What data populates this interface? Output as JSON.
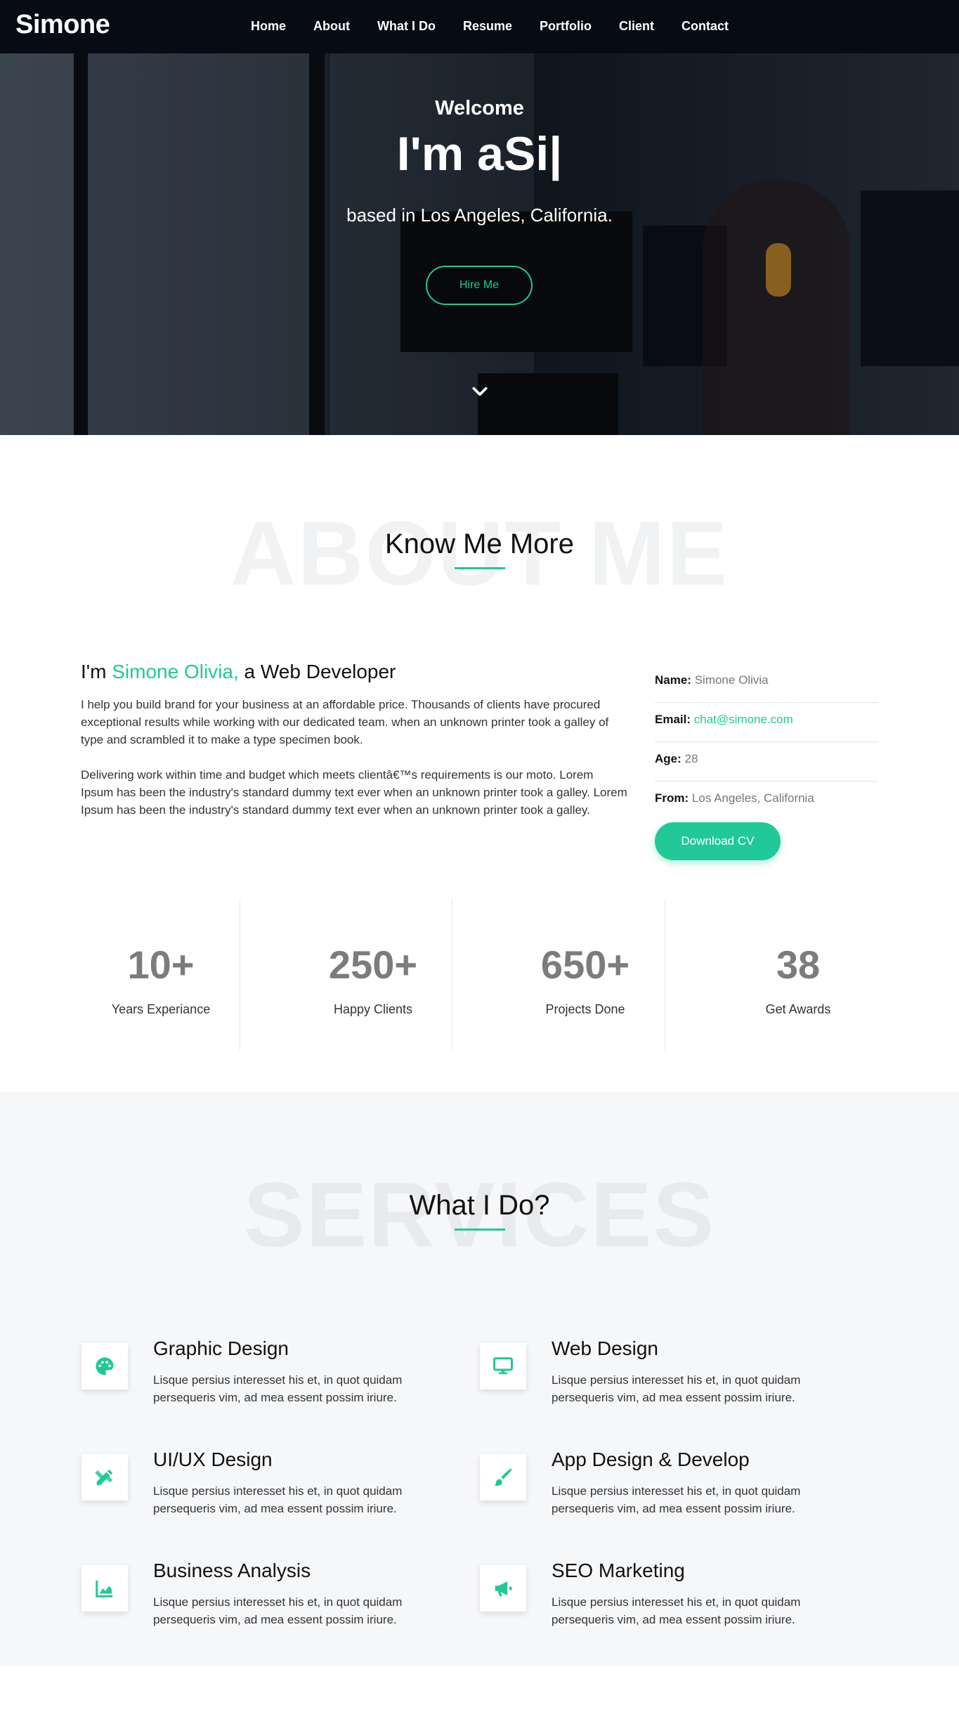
{
  "nav": {
    "brand": "Simone",
    "items": [
      "Home",
      "About",
      "What I Do",
      "Resume",
      "Portfolio",
      "Client",
      "Contact"
    ]
  },
  "hero": {
    "welcome": "Welcome",
    "typed": "I'm aSi|",
    "based": "based in Los Angeles, California.",
    "hire": "Hire Me",
    "scroll_icon": "chevron-down-icon"
  },
  "about": {
    "bg_title": "ABOUT ME",
    "title": "Know Me More",
    "head_prefix": "I'm ",
    "head_name": "Simone Olivia,",
    "head_suffix": " a Web Developer",
    "p1": "I help you build brand for your business at an affordable price. Thousands of clients have procured exceptional results while working with our dedicated team. when an unknown printer took a galley of type and scrambled it to make a type specimen book.",
    "p2": "Delivering work within time and budget which meets clientâ€™s requirements is our moto. Lorem Ipsum has been the industry's standard dummy text ever when an unknown printer took a galley. Lorem Ipsum has been the industry's standard dummy text ever when an unknown printer took a galley.",
    "info": {
      "name_label": "Name:",
      "name": "Simone Olivia",
      "email_label": "Email:",
      "email": "chat@simone.com",
      "age_label": "Age:",
      "age": "28",
      "from_label": "From:",
      "from": "Los Angeles, California"
    },
    "download": "Download CV",
    "stats": [
      {
        "num": "10+",
        "label": "Years Experiance"
      },
      {
        "num": "250+",
        "label": "Happy Clients"
      },
      {
        "num": "650+",
        "label": "Projects Done"
      },
      {
        "num": "38",
        "label": "Get Awards"
      }
    ]
  },
  "services": {
    "bg_title": "SERVICES",
    "title": "What I Do?",
    "items": [
      {
        "title": "Graphic Design",
        "desc": "Lisque persius interesset his et, in quot quidam persequeris vim, ad mea essent possim iriure.",
        "icon": "palette-icon"
      },
      {
        "title": "Web Design",
        "desc": "Lisque persius interesset his et, in quot quidam persequeris vim, ad mea essent possim iriure.",
        "icon": "desktop-icon"
      },
      {
        "title": "UI/UX Design",
        "desc": "Lisque persius interesset his et, in quot quidam persequeris vim, ad mea essent possim iriure.",
        "icon": "pencil-ruler-icon"
      },
      {
        "title": "App Design & Develop",
        "desc": "Lisque persius interesset his et, in quot quidam persequeris vim, ad mea essent possim iriure.",
        "icon": "paint-brush-icon"
      },
      {
        "title": "Business Analysis",
        "desc": "Lisque persius interesset his et, in quot quidam persequeris vim, ad mea essent possim iriure.",
        "icon": "chart-area-icon"
      },
      {
        "title": "SEO Marketing",
        "desc": "Lisque persius interesset his et, in quot quidam persequeris vim, ad mea essent possim iriure.",
        "icon": "bullhorn-icon"
      }
    ]
  },
  "colors": {
    "accent": "#20c997",
    "nav_bg": "#060b14"
  }
}
